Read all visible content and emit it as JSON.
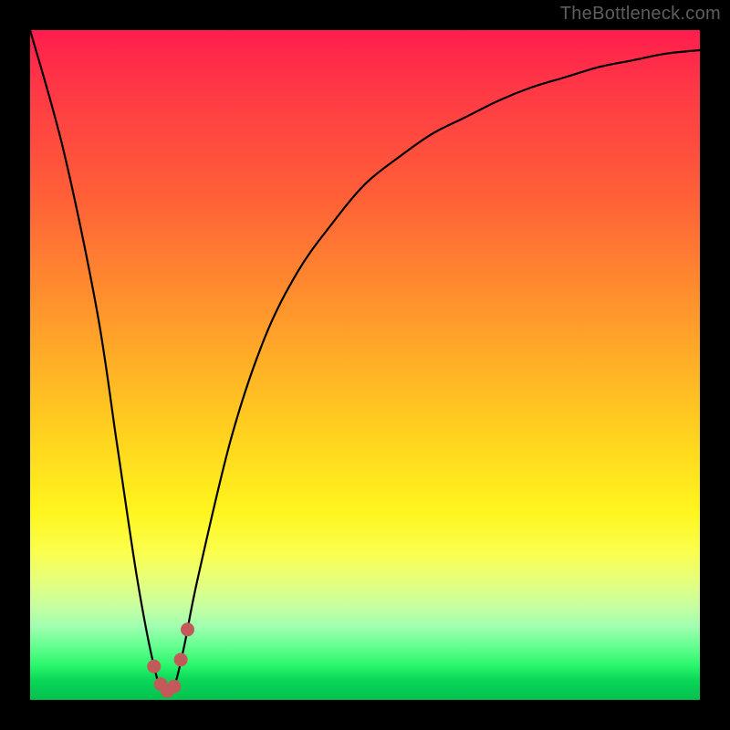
{
  "watermark": "TheBottleneck.com",
  "colors": {
    "frame": "#000000",
    "curve": "#000000",
    "marker": "#c25a5a",
    "watermark": "#5e5e5e"
  },
  "chart_data": {
    "type": "line",
    "title": "",
    "xlabel": "",
    "ylabel": "",
    "xlim": [
      0,
      100
    ],
    "ylim": [
      0,
      100
    ],
    "grid": false,
    "legend": false,
    "series": [
      {
        "name": "bottleneck_curve",
        "x": [
          0,
          5,
          10,
          13,
          16,
          18.5,
          20,
          21.5,
          23,
          25,
          30,
          35,
          40,
          45,
          50,
          55,
          60,
          65,
          70,
          75,
          80,
          85,
          90,
          95,
          100
        ],
        "values": [
          100,
          82,
          58,
          38,
          18,
          5,
          1,
          2,
          8,
          18,
          39,
          54,
          64,
          71,
          77,
          81,
          84.5,
          87,
          89.5,
          91.5,
          93,
          94.5,
          95.5,
          96.5,
          97
        ]
      }
    ],
    "annotations": {
      "minimum_region_x": [
        18.5,
        23.5
      ],
      "minimum_region_marker": "cluster"
    }
  }
}
